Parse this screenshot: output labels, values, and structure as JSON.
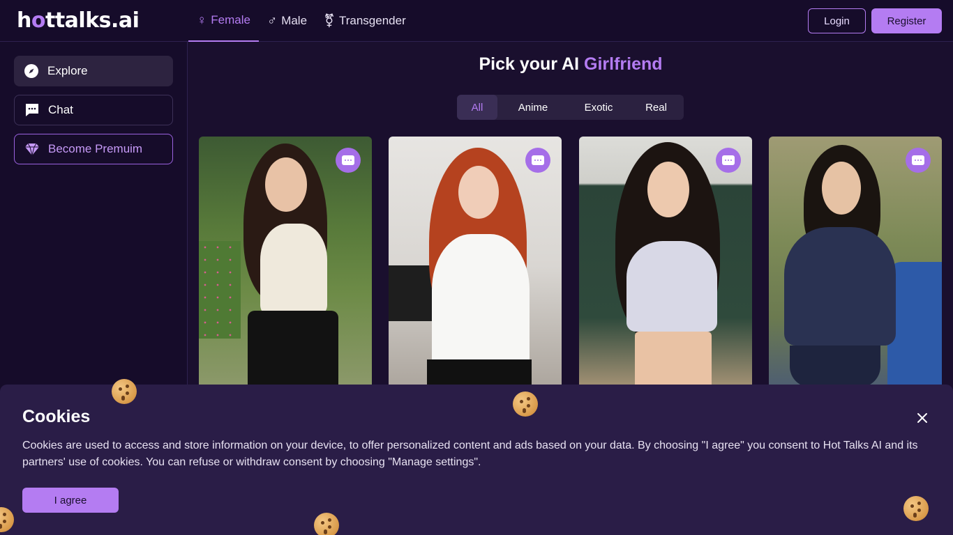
{
  "header": {
    "logo_prefix": "h",
    "logo_accent": "o",
    "logo_suffix": "ttalks.ai",
    "gender_tabs": [
      {
        "label": "Female",
        "icon": "female-icon",
        "active": true
      },
      {
        "label": "Male",
        "icon": "male-icon",
        "active": false
      },
      {
        "label": "Transgender",
        "icon": "transgender-icon",
        "active": false
      }
    ],
    "login_label": "Login",
    "register_label": "Register"
  },
  "sidebar": {
    "items": [
      {
        "label": "Explore",
        "icon": "compass-icon"
      },
      {
        "label": "Chat",
        "icon": "chat-icon"
      },
      {
        "label": "Become Premuim",
        "icon": "diamond-icon"
      }
    ]
  },
  "main": {
    "title_prefix": "Pick your AI",
    "title_accent": "Girlfriend",
    "filters": [
      "All",
      "Anime",
      "Exotic",
      "Real"
    ],
    "active_filter": "All",
    "cards": [
      {
        "icon": "chat-bubble-icon"
      },
      {
        "icon": "chat-bubble-icon"
      },
      {
        "icon": "chat-bubble-icon"
      },
      {
        "icon": "chat-bubble-icon"
      }
    ]
  },
  "cookies": {
    "title": "Cookies",
    "text": "Cookies are used to access and store information on your device, to offer personalized content and ads based on your data. By choosing \"I agree\" you consent to Hot Talks AI and its partners' use of cookies. You can refuse or withdraw consent by choosing \"Manage settings\".",
    "agree_label": "I agree"
  },
  "colors": {
    "accent": "#b47cf2",
    "background": "#1a0f2e",
    "banner": "#2a1d47"
  }
}
